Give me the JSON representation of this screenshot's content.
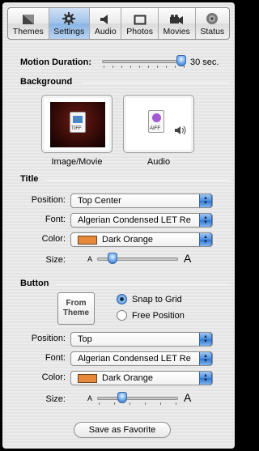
{
  "toolbar": {
    "tabs": [
      {
        "label": "Themes",
        "icon": "themes-icon"
      },
      {
        "label": "Settings",
        "icon": "gear-icon"
      },
      {
        "label": "Audio",
        "icon": "speaker-icon"
      },
      {
        "label": "Photos",
        "icon": "photo-frame-icon"
      },
      {
        "label": "Movies",
        "icon": "movie-camera-icon"
      },
      {
        "label": "Status",
        "icon": "disc-icon"
      }
    ],
    "active": "Settings"
  },
  "motion": {
    "label": "Motion Duration:",
    "value_text": "30 sec.",
    "slider_fraction": 1.0
  },
  "background": {
    "heading": "Background",
    "image_label": "Image/Movie",
    "image_badge": "TIFF",
    "audio_label": "Audio",
    "audio_badge": "AIFF"
  },
  "title": {
    "heading": "Title",
    "position_label": "Position:",
    "position_value": "Top Center",
    "font_label": "Font:",
    "font_value": "Algerian Condensed LET Re",
    "color_label": "Color:",
    "color_value": "Dark Orange",
    "color_hex": "#E6893A",
    "size_label": "Size:",
    "size_small": "A",
    "size_large": "A",
    "size_fraction": 0.15
  },
  "button": {
    "heading": "Button",
    "theme_button_line1": "From",
    "theme_button_line2": "Theme",
    "snap_label": "Snap to Grid",
    "free_label": "Free Position",
    "snap_selected": true,
    "position_label": "Position:",
    "position_value": "Top",
    "font_label": "Font:",
    "font_value": "Algerian Condensed LET Re",
    "color_label": "Color:",
    "color_value": "Dark Orange",
    "size_label": "Size:",
    "size_small": "A",
    "size_large": "A",
    "size_fraction": 0.28
  },
  "footer": {
    "save_label": "Save as Favorite"
  }
}
